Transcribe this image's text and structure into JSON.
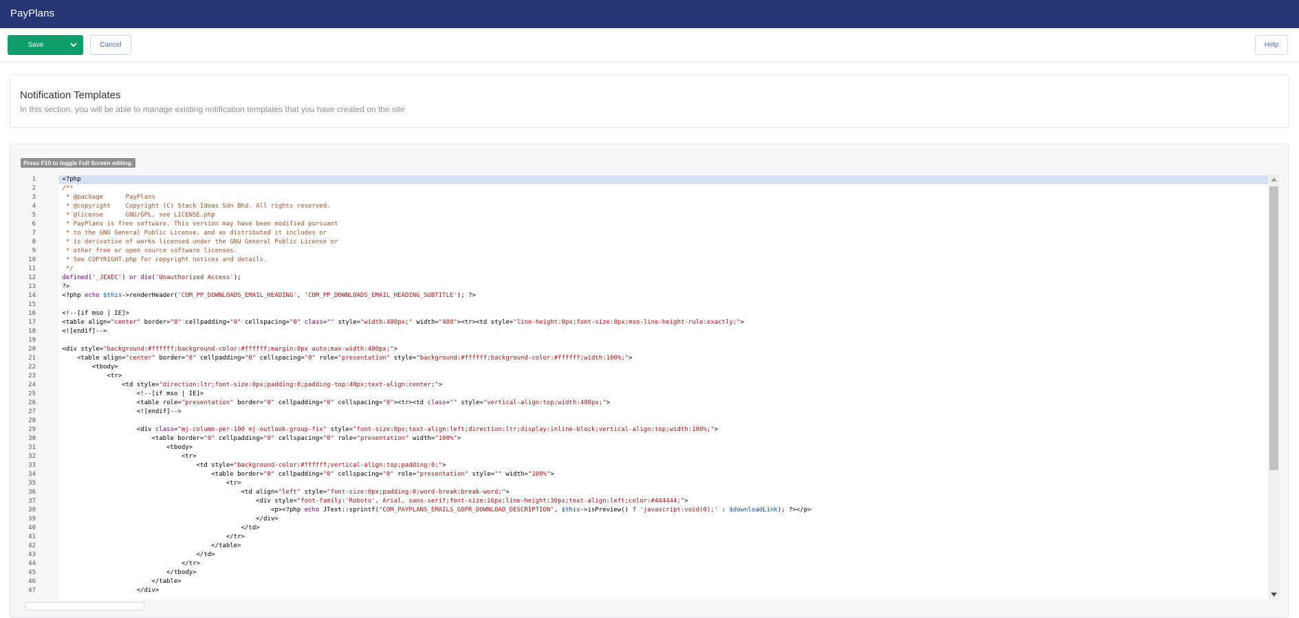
{
  "app": {
    "title": "PayPlans"
  },
  "toolbar": {
    "save_label": "Save",
    "cancel_label": "Cancel",
    "help_label": "Help"
  },
  "header": {
    "title": "Notification Templates",
    "description": "In this section, you will be able to manage existing notification templates that you have created on the site"
  },
  "editor": {
    "hint": "Press F10 to toggle Full Screen editing.",
    "active_line": 1,
    "lines": [
      [
        [
          "t",
          "<?php"
        ]
      ],
      [
        [
          "c",
          "/**"
        ]
      ],
      [
        [
          "c",
          " * @package      PayPlans"
        ]
      ],
      [
        [
          "c",
          " * @copyright    Copyright (C) Stack Ideas Sdn Bhd. All rights reserved."
        ]
      ],
      [
        [
          "c",
          " * @license      GNU/GPL, see LICENSE.php"
        ]
      ],
      [
        [
          "c",
          " * PayPlans is free software. This version may have been modified pursuant"
        ]
      ],
      [
        [
          "c",
          " * to the GNU General Public License, and as distributed it includes or"
        ]
      ],
      [
        [
          "c",
          " * is derivative of works licensed under the GNU General Public License or"
        ]
      ],
      [
        [
          "c",
          " * other free or open source software licenses."
        ]
      ],
      [
        [
          "c",
          " * See COPYRIGHT.php for copyright notices and details."
        ]
      ],
      [
        [
          "c",
          " */"
        ]
      ],
      [
        [
          "k",
          "defined"
        ],
        [
          "t",
          "("
        ],
        [
          "s",
          "'_JEXEC'"
        ],
        [
          "t",
          ") "
        ],
        [
          "k",
          "or"
        ],
        [
          "t",
          " "
        ],
        [
          "k",
          "die"
        ],
        [
          "t",
          "("
        ],
        [
          "s",
          "'Unauthorized Access'"
        ],
        [
          "t",
          ");"
        ]
      ],
      [
        [
          "t",
          "?>"
        ]
      ],
      [
        [
          "t",
          "<?php "
        ],
        [
          "k",
          "echo"
        ],
        [
          "t",
          " "
        ],
        [
          "v",
          "$this"
        ],
        [
          "t",
          "->renderHeader("
        ],
        [
          "s",
          "'COM_PP_DOWNLOADS_EMAIL_HEADING'"
        ],
        [
          "t",
          ", "
        ],
        [
          "s",
          "'COM_PP_DOWNLOADS_EMAIL_HEADING_SUBTITLE'"
        ],
        [
          "t",
          "); ?>"
        ]
      ],
      [
        [
          "t",
          ""
        ]
      ],
      [
        [
          "t",
          "<!--[if mso | IE]>"
        ]
      ],
      [
        [
          "t",
          "<table align="
        ],
        [
          "s",
          "\"center\""
        ],
        [
          "t",
          " border="
        ],
        [
          "s",
          "\"0\""
        ],
        [
          "t",
          " cellpadding="
        ],
        [
          "s",
          "\"0\""
        ],
        [
          "t",
          " cellspacing="
        ],
        [
          "s",
          "\"0\""
        ],
        [
          "t",
          " "
        ],
        [
          "k",
          "class"
        ],
        [
          "t",
          "="
        ],
        [
          "s",
          "\"\""
        ],
        [
          "t",
          " style="
        ],
        [
          "s",
          "\"width:480px;\""
        ],
        [
          "t",
          " width="
        ],
        [
          "s",
          "\"480\""
        ],
        [
          "t",
          "><tr><td style="
        ],
        [
          "s",
          "\"line-height:0px;font-size:0px;mso-line-height-rule:exactly;\""
        ],
        [
          "t",
          ">"
        ]
      ],
      [
        [
          "t",
          "<![endif]-->"
        ]
      ],
      [
        [
          "t",
          ""
        ]
      ],
      [
        [
          "t",
          "<div style="
        ],
        [
          "s",
          "\"background:#ffffff;background-color:#ffffff;margin:0px auto;max-width:480px;\""
        ],
        [
          "t",
          ">"
        ]
      ],
      [
        [
          "t",
          "    <table align="
        ],
        [
          "s",
          "\"center\""
        ],
        [
          "t",
          " border="
        ],
        [
          "s",
          "\"0\""
        ],
        [
          "t",
          " cellpadding="
        ],
        [
          "s",
          "\"0\""
        ],
        [
          "t",
          " cellspacing="
        ],
        [
          "s",
          "\"0\""
        ],
        [
          "t",
          " role="
        ],
        [
          "s",
          "\"presentation\""
        ],
        [
          "t",
          " style="
        ],
        [
          "s",
          "\"background:#ffffff;background-color:#ffffff;width:100%;\""
        ],
        [
          "t",
          ">"
        ]
      ],
      [
        [
          "t",
          "        <tbody>"
        ]
      ],
      [
        [
          "t",
          "            <tr>"
        ]
      ],
      [
        [
          "t",
          "                <td style="
        ],
        [
          "s",
          "\"direction:ltr;font-size:0px;padding:0;padding-top:40px;text-align:center;\""
        ],
        [
          "t",
          ">"
        ]
      ],
      [
        [
          "t",
          "                    <!--[if mso | IE]>"
        ]
      ],
      [
        [
          "t",
          "                    <table role="
        ],
        [
          "s",
          "\"presentation\""
        ],
        [
          "t",
          " border="
        ],
        [
          "s",
          "\"0\""
        ],
        [
          "t",
          " cellpadding="
        ],
        [
          "s",
          "\"0\""
        ],
        [
          "t",
          " cellspacing="
        ],
        [
          "s",
          "\"0\""
        ],
        [
          "t",
          "><tr><td "
        ],
        [
          "k",
          "class"
        ],
        [
          "t",
          "="
        ],
        [
          "s",
          "\"\""
        ],
        [
          "t",
          " style="
        ],
        [
          "s",
          "\"vertical-align:top;width:480px;\""
        ],
        [
          "t",
          ">"
        ]
      ],
      [
        [
          "t",
          "                    <![endif]-->"
        ]
      ],
      [
        [
          "t",
          ""
        ]
      ],
      [
        [
          "t",
          "                    <div "
        ],
        [
          "k",
          "class"
        ],
        [
          "t",
          "="
        ],
        [
          "s",
          "\"mj-column-per-100 mj-outlook-group-fix\""
        ],
        [
          "t",
          " style="
        ],
        [
          "s",
          "\"font-size:0px;text-align:left;direction:ltr;display:inline-block;vertical-align:top;width:100%;\""
        ],
        [
          "t",
          ">"
        ]
      ],
      [
        [
          "t",
          "                        <table border="
        ],
        [
          "s",
          "\"0\""
        ],
        [
          "t",
          " cellpadding="
        ],
        [
          "s",
          "\"0\""
        ],
        [
          "t",
          " cellspacing="
        ],
        [
          "s",
          "\"0\""
        ],
        [
          "t",
          " role="
        ],
        [
          "s",
          "\"presentation\""
        ],
        [
          "t",
          " width="
        ],
        [
          "s",
          "\"100%\""
        ],
        [
          "t",
          ">"
        ]
      ],
      [
        [
          "t",
          "                            <tbody>"
        ]
      ],
      [
        [
          "t",
          "                                <tr>"
        ]
      ],
      [
        [
          "t",
          "                                    <td style="
        ],
        [
          "s",
          "\"background-color:#ffffff;vertical-align:top;padding:0;\""
        ],
        [
          "t",
          ">"
        ]
      ],
      [
        [
          "t",
          "                                        <table border="
        ],
        [
          "s",
          "\"0\""
        ],
        [
          "t",
          " cellpadding="
        ],
        [
          "s",
          "\"0\""
        ],
        [
          "t",
          " cellspacing="
        ],
        [
          "s",
          "\"0\""
        ],
        [
          "t",
          " role="
        ],
        [
          "s",
          "\"presentation\""
        ],
        [
          "t",
          " style="
        ],
        [
          "s",
          "\"\""
        ],
        [
          "t",
          " width="
        ],
        [
          "s",
          "\"100%\""
        ],
        [
          "t",
          ">"
        ]
      ],
      [
        [
          "t",
          "                                            <tr>"
        ]
      ],
      [
        [
          "t",
          "                                                <td align="
        ],
        [
          "s",
          "\"left\""
        ],
        [
          "t",
          " style="
        ],
        [
          "s",
          "\"font-size:0px;padding:0;word-break:break-word;\""
        ],
        [
          "t",
          ">"
        ]
      ],
      [
        [
          "t",
          "                                                    <div style="
        ],
        [
          "s",
          "\"font-family:'Roboto', Arial, sans-serif;font-size:16px;line-height:30px;text-align:left;color:#444444;\""
        ],
        [
          "t",
          ">"
        ]
      ],
      [
        [
          "t",
          "                                                        <p><?php "
        ],
        [
          "k",
          "echo"
        ],
        [
          "t",
          " JText::sprintf("
        ],
        [
          "s",
          "\"COM_PAYPLANS_EMAILS_GDPR_DOWNLOAD_DESCRIPTION\""
        ],
        [
          "t",
          ", "
        ],
        [
          "v",
          "$this"
        ],
        [
          "t",
          "->isPreview() ? "
        ],
        [
          "s",
          "'javascript:void(0);'"
        ],
        [
          "t",
          " : "
        ],
        [
          "v",
          "$downloadLink"
        ],
        [
          "t",
          "); ?></p>"
        ]
      ],
      [
        [
          "t",
          "                                                    </div>"
        ]
      ],
      [
        [
          "t",
          "                                                </td>"
        ]
      ],
      [
        [
          "t",
          "                                            </tr>"
        ]
      ],
      [
        [
          "t",
          "                                        </table>"
        ]
      ],
      [
        [
          "t",
          "                                    </td>"
        ]
      ],
      [
        [
          "t",
          "                                </tr>"
        ]
      ],
      [
        [
          "t",
          "                            </tbody>"
        ]
      ],
      [
        [
          "t",
          "                        </table>"
        ]
      ],
      [
        [
          "t",
          "                    </div>"
        ]
      ]
    ]
  }
}
